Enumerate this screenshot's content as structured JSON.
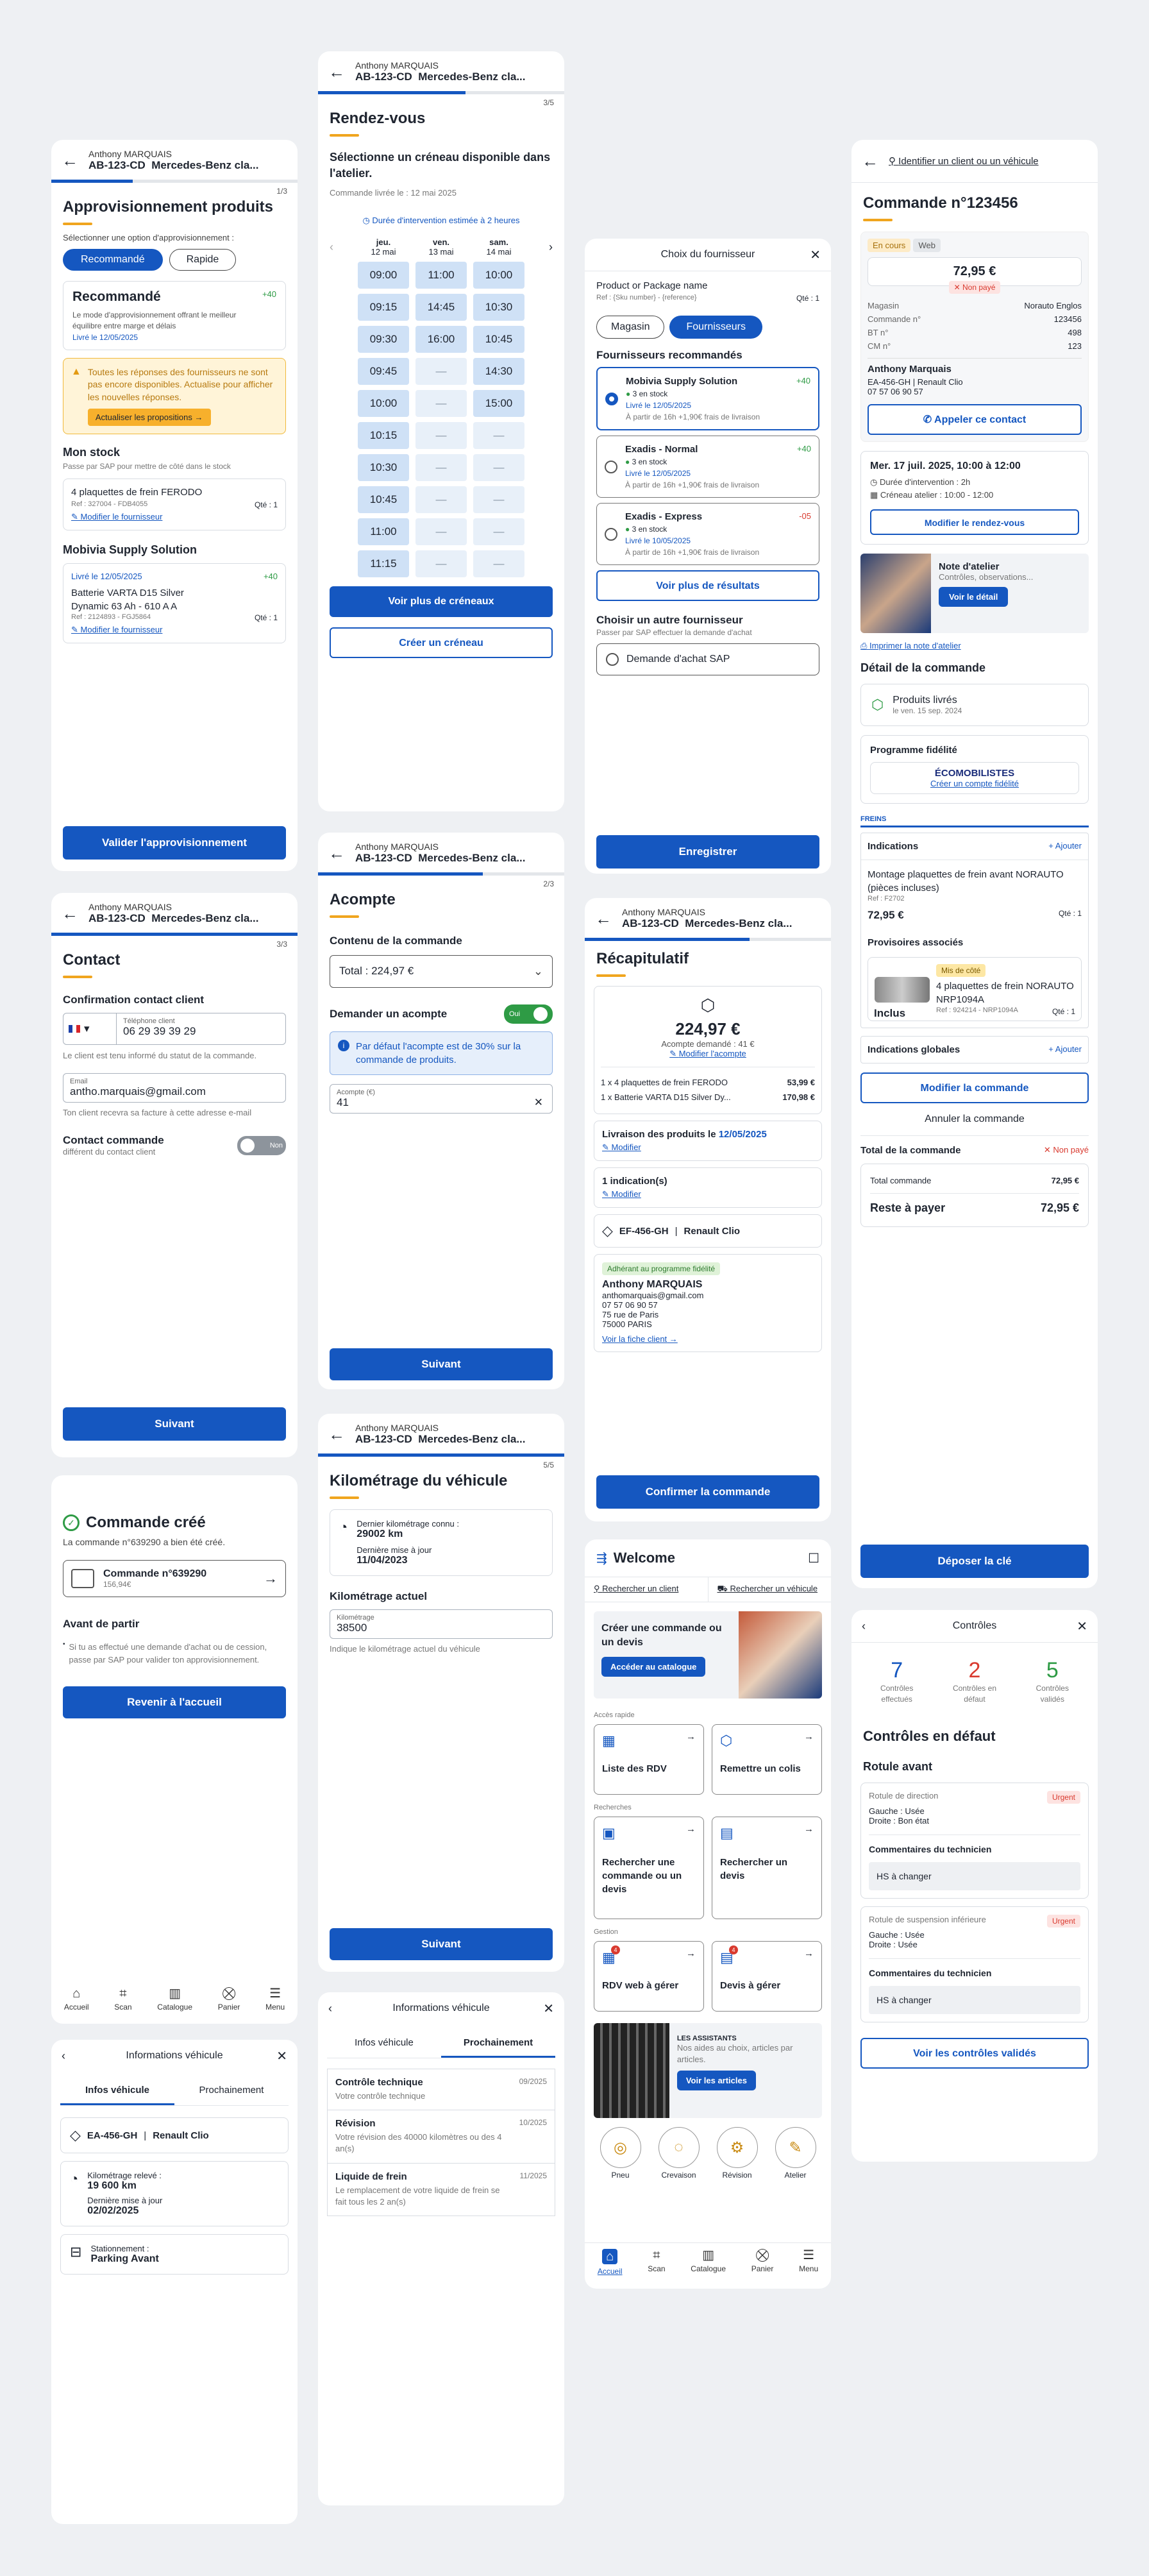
{
  "p1": {
    "who": "Anthony MARQUAIS",
    "plate": "AB-123-CD",
    "car": "Mercedes-Benz cla...",
    "step": "1/3",
    "title": "Approvisionnement produits",
    "hint": "Sélectionner une option d'approvisionnement :",
    "tab1": "Recommandé",
    "tab2": "Rapide",
    "rec_title": "Recommandé",
    "rec_delta": "+40",
    "rec_desc": "Le mode d'approvisionnement offrant le meilleur équilibre entre marge et délais",
    "rec_date": "Livré le 12/05/2025",
    "warn": "Toutes les réponses des fournisseurs ne sont pas encore disponibles. Actualise pour afficher les nouvelles réponses.",
    "warn_btn": "Actualiser les propositions",
    "stock_title": "Mon stock",
    "stock_sub": "Passe par SAP pour mettre de côté dans le stock",
    "stock_item": "4 plaquettes de frein FERODO",
    "stock_ref": "Ref : 327004 - FDB4055",
    "stock_qty": "Qté : 1",
    "stock_link": "Modifier le fournisseur",
    "sup_title": "Mobivia Supply Solution",
    "sup_date": "Livré le 12/05/2025",
    "sup_delta": "+40",
    "sup_item": "Batterie VARTA D15 Silver Dynamic 63 Ah - 610 A A",
    "sup_ref": "Ref : 2124893 - FGJ5864",
    "sup_qty": "Qté : 1",
    "sup_link": "Modifier le fournisseur",
    "cta": "Valider l'approvisionnement"
  },
  "p2": {
    "who": "Anthony MARQUAIS",
    "plate": "AB-123-CD",
    "car": "Mercedes-Benz cla...",
    "step": "3/5",
    "title": "Rendez-vous",
    "sub": "Sélectionne un créneau disponible dans l'atelier.",
    "delivered": "Commande livrée le : 12 mai 2025",
    "duration": "Durée d'intervention estimée à 2 heures",
    "days": [
      {
        "d": "jeu.",
        "n": "12 mai"
      },
      {
        "d": "ven.",
        "n": "13 mai"
      },
      {
        "d": "sam.",
        "n": "14 mai"
      }
    ],
    "col1": [
      "09:00",
      "09:15",
      "09:30",
      "09:45",
      "10:00",
      "10:15",
      "10:30",
      "10:45",
      "11:00",
      "11:15"
    ],
    "col2": [
      "11:00",
      "14:45",
      "16:00",
      "—",
      "—",
      "—",
      "—",
      "—",
      "—",
      "—"
    ],
    "col3": [
      "10:00",
      "10:30",
      "10:45",
      "14:30",
      "15:00",
      "—",
      "—",
      "—",
      "—",
      "—"
    ],
    "more": "Voir plus de créneaux",
    "create": "Créer un créneau"
  },
  "p3": {
    "title": "Choix du fournisseur",
    "product": "Product or Package name",
    "ref": "Ref : {Sku number} - {reference}",
    "qty": "Qté : 1",
    "tab1": "Magasin",
    "tab2": "Fournisseurs",
    "rec": "Fournisseurs recommandés",
    "sups": [
      {
        "name": "Mobivia Supply Solution",
        "delta": "+40",
        "stock": "3 en stock",
        "date": "Livré le 12/05/2025",
        "fee": "À partir de 16h +1,90€ frais de livraison"
      },
      {
        "name": "Exadis - Normal",
        "delta": "+40",
        "stock": "3 en stock",
        "date": "Livré le 12/05/2025",
        "fee": "À partir de 16h +1,90€ frais de livraison"
      },
      {
        "name": "Exadis - Express",
        "delta": "-05",
        "stock": "3 en stock",
        "date": "Livré le 10/05/2025",
        "fee": "À partir de 16h +1,90€ frais de livraison"
      }
    ],
    "more": "Voir plus de résultats",
    "other": "Choisir un autre fournisseur",
    "other_sub": "Passer par SAP effectuer la demande d'achat",
    "sap": "Demande d'achat SAP",
    "save": "Enregistrer"
  },
  "p4": {
    "crumb": "Identifier un client ou un véhicule",
    "title": "Commande n°123456",
    "tag1": "En cours",
    "tag2": "Web",
    "amount": "72,95 €",
    "unpaid": "Non payé",
    "rows": [
      [
        "Magasin",
        "Norauto Englos"
      ],
      [
        "Commande n°",
        "123456"
      ],
      [
        "BT n°",
        "498"
      ],
      [
        "CM n°",
        "123"
      ]
    ],
    "client": "Anthony Marquais",
    "veh": "EA-456-GH | Renault Clio",
    "phone": "07 57 06 90 57",
    "call": "Appeler ce contact",
    "rdv": "Mer. 17 juil. 2025, 10:00 à 12:00",
    "dur": "Durée d'intervention : 2h",
    "slot": "Créneau atelier : 10:00 - 12:00",
    "mod_rdv": "Modifier le rendez-vous",
    "note_t": "Note d'atelier",
    "note_s": "Contrôles, observations...",
    "note_b": "Voir le détail",
    "print": "Imprimer la note d'atelier",
    "detail": "Détail de la commande",
    "deliv": "Produits livrés",
    "deliv_d": "le ven. 15 sep. 2024",
    "prog": "Programme fidélité",
    "eco": "ÉCOMOBILISTES",
    "eco_l": "Créer un compte fidélité",
    "freins": "FREINS",
    "ind": "Indications",
    "add": "Ajouter",
    "item": "Montage plaquettes de frein avant NORAUTO (pièces incluses)",
    "item_ref": "Ref : F2702",
    "item_price": "72,95 €",
    "item_qty": "Qté : 1",
    "prov": "Provisoires associés",
    "mis": "Mis de côté",
    "prov_item": "4 plaquettes de frein NORAUTO NRP1094A",
    "prov_ref": "Ref : 924214 - NRP1094A",
    "incl": "Inclus",
    "prov_qty": "Qté : 1",
    "glob": "Indications globales",
    "add2": "Ajouter",
    "mod": "Modifier la commande",
    "cancel": "Annuler la commande",
    "tot_t": "Total de la commande",
    "unpaid2": "Non payé",
    "tot_l": "Total commande",
    "tot_v": "72,95 €",
    "rest_l": "Reste à payer",
    "rest_v": "72,95 €",
    "key": "Déposer la clé"
  },
  "p5": {
    "who": "Anthony MARQUAIS",
    "plate": "AB-123-CD",
    "car": "Mercedes-Benz cla...",
    "step": "2/3",
    "title": "Acompte",
    "content": "Contenu de la commande",
    "total": "Total : 224,97 €",
    "ask": "Demander un acompte",
    "toggle": "Oui",
    "info": "Par défaut l'acompte est de 30% sur la commande de produits.",
    "acc_lab": "Acompte (€)",
    "acc_val": "41",
    "cta": "Suivant"
  },
  "p6": {
    "who": "Anthony MARQUAIS",
    "plate": "AB-123-CD",
    "car": "Mercedes-Benz cla...",
    "step": "3/3",
    "title": "Contact",
    "conf": "Confirmation contact client",
    "tel_lab": "Téléphone client",
    "tel": "06 29 39 39 29",
    "tel_hint": "Le client est tenu informé du statut de la commande.",
    "email_lab": "Email",
    "email": "antho.marquais@gmail.com",
    "email_hint": "Ton client recevra sa facture à cette adresse e-mail",
    "cc": "Contact commande",
    "cc_sub": "différent du contact client",
    "toggle": "Non",
    "cta": "Suivant"
  },
  "p7": {
    "who": "Anthony MARQUAIS",
    "plate": "AB-123-CD",
    "car": "Mercedes-Benz cla...",
    "step": "2/3",
    "title": "Récapitulatif",
    "amount": "224,97 €",
    "dep": "Acompte demandé : 41 €",
    "mod_dep": "Modifier l'acompte",
    "l1": "1 x 4 plaquettes de frein FERODO",
    "p1": "53,99 €",
    "l2": "1 x Batterie VARTA D15 Silver Dy...",
    "p2": "170,98 €",
    "deliv": "Livraison des produits le ",
    "deliv_d": "12/05/2025",
    "mod1": "Modifier",
    "ind": "1 indication(s)",
    "mod2": "Modifier",
    "veh": "EF-456-GH",
    "model": "Renault Clio",
    "fid": "Adhérant au programme fidélité",
    "name": "Anthony MARQUAIS",
    "mail": "anthomarquais@gmail.com",
    "phone": "07 57 06 90 57",
    "addr1": "75 rue de Paris",
    "addr2": "75000 PARIS",
    "card": "Voir la fiche client",
    "cta": "Confirmer la commande"
  },
  "p8": {
    "title": "Commande créé",
    "sub": "La commande n°639290 a bien été créé.",
    "order": "Commande n°639290",
    "amount": "156,94€",
    "before": "Avant de partir",
    "note": "Si tu as effectué une demande d'achat ou de cession, passe par SAP pour valider ton approvisionnement.",
    "cta": "Revenir à l'accueil",
    "tabs": [
      "Accueil",
      "Scan",
      "Catalogue",
      "Panier",
      "Menu"
    ]
  },
  "p9": {
    "who": "Anthony MARQUAIS",
    "plate": "AB-123-CD",
    "car": "Mercedes-Benz cla...",
    "step": "5/5",
    "title": "Kilométrage du véhicule",
    "last_l": "Dernier kilométrage connu :",
    "last_v": "29002 km",
    "upd_l": "Dernière mise à jour",
    "upd_v": "11/04/2023",
    "cur": "Kilométrage actuel",
    "km_lab": "Kilométrage",
    "km_val": "38500",
    "hint": "Indique le kilométrage actuel du véhicule",
    "cta": "Suivant"
  },
  "p10": {
    "title": "Welcome",
    "s1": "Rechercher un client",
    "s2": "Rechercher un véhicule",
    "promo": "Créer une commande ou un devis",
    "promo_b": "Accéder au catalogue",
    "quick": "Accès rapide",
    "q1": "Liste des RDV",
    "q2": "Remettre un colis",
    "searches": "Recherches",
    "r1": "Rechercher une commande ou un devis",
    "r2": "Rechercher un devis",
    "gest": "Gestion",
    "g1": "RDV web à gérer",
    "g2": "Devis à gérer",
    "assist": "LES ASSISTANTS",
    "assist_s": "Nos aides au choix, articles par articles.",
    "assist_b": "Voir les articles",
    "circ": [
      "Pneu",
      "Crevaison",
      "Révision",
      "Atelier"
    ],
    "tabs": [
      "Accueil",
      "Scan",
      "Catalogue",
      "Panier",
      "Menu"
    ]
  },
  "p11": {
    "title": "Contrôles",
    "n1": "7",
    "l1": "Contrôles effectués",
    "n2": "2",
    "l2": "Contrôles en défaut",
    "n3": "5",
    "l3": "Contrôles validés",
    "def": "Contrôles en défaut",
    "rot": "Rotule avant",
    "c1": "Rotule de direction",
    "u1": "Urgent",
    "c1a": "Gauche : Usée",
    "c1b": "Droite : Bon état",
    "com": "Commentaires du technicien",
    "hs": "HS à changer",
    "c2": "Rotule de suspension inférieure",
    "u2": "Urgent",
    "c2a": "Gauche : Usée",
    "c2b": "Droite : Usée",
    "com2": "Commentaires du technicien",
    "hs2": "HS à changer",
    "cta": "Voir les contrôles validés"
  },
  "p12": {
    "title": "Informations véhicule",
    "tab1": "Infos véhicule",
    "tab2": "Prochainement",
    "veh": "EA-456-GH",
    "model": "Renault Clio",
    "km_l": "Kilométrage relevé :",
    "km_v": "19 600 km",
    "upd_l": "Dernière mise à jour",
    "upd_v": "02/02/2025",
    "park_l": "Stationnement :",
    "park_v": "Parking Avant"
  },
  "p13": {
    "title": "Informations véhicule",
    "tab1": "Infos véhicule",
    "tab2": "Prochainement",
    "items": [
      {
        "t": "Contrôle technique",
        "s": "Votre contrôle technique",
        "d": "09/2025"
      },
      {
        "t": "Révision",
        "s": "Votre révision des 40000 kilomètres ou des 4 an(s)",
        "d": "10/2025"
      },
      {
        "t": "Liquide de frein",
        "s": "Le remplacement de votre liquide de frein se fait tous les 2 an(s)",
        "d": "11/2025"
      }
    ]
  }
}
